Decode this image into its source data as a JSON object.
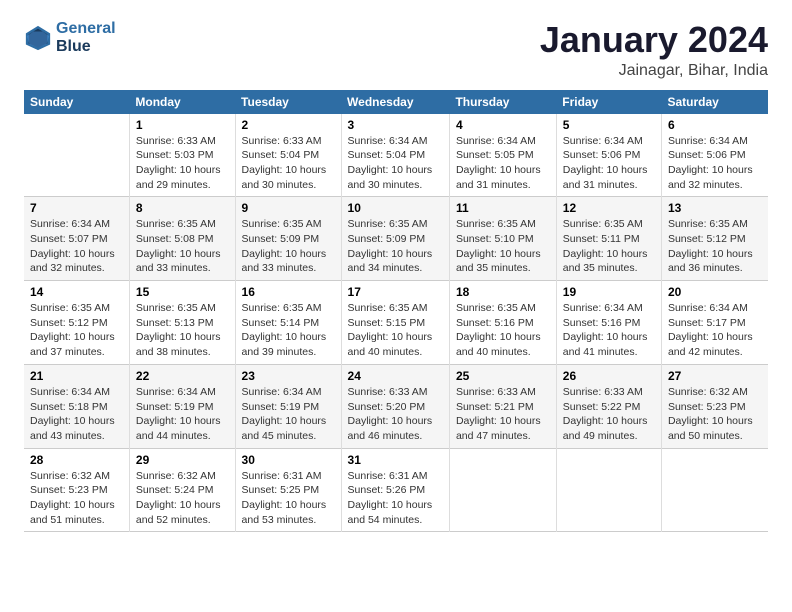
{
  "header": {
    "logo_line1": "General",
    "logo_line2": "Blue",
    "title": "January 2024",
    "subtitle": "Jainagar, Bihar, India"
  },
  "days_header": [
    "Sunday",
    "Monday",
    "Tuesday",
    "Wednesday",
    "Thursday",
    "Friday",
    "Saturday"
  ],
  "weeks": [
    [
      {
        "day": "",
        "lines": []
      },
      {
        "day": "1",
        "lines": [
          "Sunrise: 6:33 AM",
          "Sunset: 5:03 PM",
          "Daylight: 10 hours",
          "and 29 minutes."
        ]
      },
      {
        "day": "2",
        "lines": [
          "Sunrise: 6:33 AM",
          "Sunset: 5:04 PM",
          "Daylight: 10 hours",
          "and 30 minutes."
        ]
      },
      {
        "day": "3",
        "lines": [
          "Sunrise: 6:34 AM",
          "Sunset: 5:04 PM",
          "Daylight: 10 hours",
          "and 30 minutes."
        ]
      },
      {
        "day": "4",
        "lines": [
          "Sunrise: 6:34 AM",
          "Sunset: 5:05 PM",
          "Daylight: 10 hours",
          "and 31 minutes."
        ]
      },
      {
        "day": "5",
        "lines": [
          "Sunrise: 6:34 AM",
          "Sunset: 5:06 PM",
          "Daylight: 10 hours",
          "and 31 minutes."
        ]
      },
      {
        "day": "6",
        "lines": [
          "Sunrise: 6:34 AM",
          "Sunset: 5:06 PM",
          "Daylight: 10 hours",
          "and 32 minutes."
        ]
      }
    ],
    [
      {
        "day": "7",
        "lines": [
          "Sunrise: 6:34 AM",
          "Sunset: 5:07 PM",
          "Daylight: 10 hours",
          "and 32 minutes."
        ]
      },
      {
        "day": "8",
        "lines": [
          "Sunrise: 6:35 AM",
          "Sunset: 5:08 PM",
          "Daylight: 10 hours",
          "and 33 minutes."
        ]
      },
      {
        "day": "9",
        "lines": [
          "Sunrise: 6:35 AM",
          "Sunset: 5:09 PM",
          "Daylight: 10 hours",
          "and 33 minutes."
        ]
      },
      {
        "day": "10",
        "lines": [
          "Sunrise: 6:35 AM",
          "Sunset: 5:09 PM",
          "Daylight: 10 hours",
          "and 34 minutes."
        ]
      },
      {
        "day": "11",
        "lines": [
          "Sunrise: 6:35 AM",
          "Sunset: 5:10 PM",
          "Daylight: 10 hours",
          "and 35 minutes."
        ]
      },
      {
        "day": "12",
        "lines": [
          "Sunrise: 6:35 AM",
          "Sunset: 5:11 PM",
          "Daylight: 10 hours",
          "and 35 minutes."
        ]
      },
      {
        "day": "13",
        "lines": [
          "Sunrise: 6:35 AM",
          "Sunset: 5:12 PM",
          "Daylight: 10 hours",
          "and 36 minutes."
        ]
      }
    ],
    [
      {
        "day": "14",
        "lines": [
          "Sunrise: 6:35 AM",
          "Sunset: 5:12 PM",
          "Daylight: 10 hours",
          "and 37 minutes."
        ]
      },
      {
        "day": "15",
        "lines": [
          "Sunrise: 6:35 AM",
          "Sunset: 5:13 PM",
          "Daylight: 10 hours",
          "and 38 minutes."
        ]
      },
      {
        "day": "16",
        "lines": [
          "Sunrise: 6:35 AM",
          "Sunset: 5:14 PM",
          "Daylight: 10 hours",
          "and 39 minutes."
        ]
      },
      {
        "day": "17",
        "lines": [
          "Sunrise: 6:35 AM",
          "Sunset: 5:15 PM",
          "Daylight: 10 hours",
          "and 40 minutes."
        ]
      },
      {
        "day": "18",
        "lines": [
          "Sunrise: 6:35 AM",
          "Sunset: 5:16 PM",
          "Daylight: 10 hours",
          "and 40 minutes."
        ]
      },
      {
        "day": "19",
        "lines": [
          "Sunrise: 6:34 AM",
          "Sunset: 5:16 PM",
          "Daylight: 10 hours",
          "and 41 minutes."
        ]
      },
      {
        "day": "20",
        "lines": [
          "Sunrise: 6:34 AM",
          "Sunset: 5:17 PM",
          "Daylight: 10 hours",
          "and 42 minutes."
        ]
      }
    ],
    [
      {
        "day": "21",
        "lines": [
          "Sunrise: 6:34 AM",
          "Sunset: 5:18 PM",
          "Daylight: 10 hours",
          "and 43 minutes."
        ]
      },
      {
        "day": "22",
        "lines": [
          "Sunrise: 6:34 AM",
          "Sunset: 5:19 PM",
          "Daylight: 10 hours",
          "and 44 minutes."
        ]
      },
      {
        "day": "23",
        "lines": [
          "Sunrise: 6:34 AM",
          "Sunset: 5:19 PM",
          "Daylight: 10 hours",
          "and 45 minutes."
        ]
      },
      {
        "day": "24",
        "lines": [
          "Sunrise: 6:33 AM",
          "Sunset: 5:20 PM",
          "Daylight: 10 hours",
          "and 46 minutes."
        ]
      },
      {
        "day": "25",
        "lines": [
          "Sunrise: 6:33 AM",
          "Sunset: 5:21 PM",
          "Daylight: 10 hours",
          "and 47 minutes."
        ]
      },
      {
        "day": "26",
        "lines": [
          "Sunrise: 6:33 AM",
          "Sunset: 5:22 PM",
          "Daylight: 10 hours",
          "and 49 minutes."
        ]
      },
      {
        "day": "27",
        "lines": [
          "Sunrise: 6:32 AM",
          "Sunset: 5:23 PM",
          "Daylight: 10 hours",
          "and 50 minutes."
        ]
      }
    ],
    [
      {
        "day": "28",
        "lines": [
          "Sunrise: 6:32 AM",
          "Sunset: 5:23 PM",
          "Daylight: 10 hours",
          "and 51 minutes."
        ]
      },
      {
        "day": "29",
        "lines": [
          "Sunrise: 6:32 AM",
          "Sunset: 5:24 PM",
          "Daylight: 10 hours",
          "and 52 minutes."
        ]
      },
      {
        "day": "30",
        "lines": [
          "Sunrise: 6:31 AM",
          "Sunset: 5:25 PM",
          "Daylight: 10 hours",
          "and 53 minutes."
        ]
      },
      {
        "day": "31",
        "lines": [
          "Sunrise: 6:31 AM",
          "Sunset: 5:26 PM",
          "Daylight: 10 hours",
          "and 54 minutes."
        ]
      },
      {
        "day": "",
        "lines": []
      },
      {
        "day": "",
        "lines": []
      },
      {
        "day": "",
        "lines": []
      }
    ]
  ]
}
